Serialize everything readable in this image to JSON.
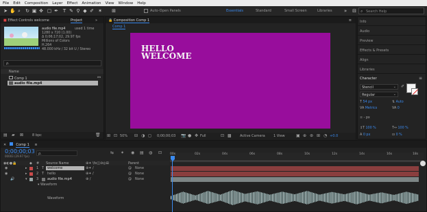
{
  "menu": [
    "File",
    "Edit",
    "Composition",
    "Layer",
    "Effect",
    "Animation",
    "View",
    "Window",
    "Help"
  ],
  "toolbar": {
    "auto_open": "Auto-Open Panels",
    "workspaces": [
      "Essentials",
      "Standard",
      "Small Screen",
      "Libraries"
    ],
    "search_placeholder": "Search Help"
  },
  "project": {
    "effect_tab": "Effect Controls welcome",
    "project_tab": "Project",
    "file_name": "audio file.mp4",
    "used": "used 1 time",
    "dims": "1280 x 720 (1.00)",
    "duration": "Δ 0;06;17;02, 29.97 fps",
    "colors": "Millions of Colors",
    "codec": "H.264",
    "audio": "48.000 kHz / 32 bit U / Stereo",
    "search_placeholder": "ρ.",
    "col_name": "Name",
    "items": [
      "Comp 1",
      "audio file.mp4"
    ],
    "bpc": "8 bpc"
  },
  "composition": {
    "tab": "Composition Comp 1",
    "breadcrumb": "Comp 1",
    "text_line1": "HELLO",
    "text_line2": "WELCOME",
    "canvas_color": "#980d9c",
    "zoom": "50%",
    "timecode": "0;00;00;03",
    "resolution": "Full",
    "camera": "Active Camera",
    "view": "1 View",
    "offset": "+0.0"
  },
  "right_panel": {
    "items": [
      "Info",
      "Audio",
      "Preview",
      "Effects & Presets",
      "Align",
      "Libraries"
    ],
    "character_title": "Character",
    "font": "Stencil",
    "style": "Regular",
    "size": "54 px",
    "leading": "Auto",
    "kerning": "Metrics",
    "tracking": "0",
    "stroke": "- px",
    "vscale": "100 %",
    "hscale": "100 %",
    "baseline": "0 px",
    "tsume": "0 %"
  },
  "timeline": {
    "tab": "Comp 1",
    "timecode": "0;00;00;03",
    "fps": "00003 (29.97 fps)",
    "search_placeholder": "ρ.",
    "col_source": "Source Name",
    "col_parent": "Parent",
    "layers": [
      {
        "num": "1",
        "type": "T",
        "name": "welcome",
        "parent": "None",
        "color": "#c84a4a"
      },
      {
        "num": "2",
        "type": "T",
        "name": "hello",
        "parent": "None",
        "color": "#c84a4a"
      },
      {
        "num": "3",
        "type": "",
        "name": "audio file.mp4",
        "parent": "None",
        "color": "#9aa6a6"
      }
    ],
    "waveform_group": "Waveform",
    "waveform_label": "Waveform",
    "ticks": [
      "00s",
      "02s",
      "04s",
      "06s",
      "08s",
      "10s",
      "12s",
      "14s",
      "16s",
      "18s"
    ]
  }
}
